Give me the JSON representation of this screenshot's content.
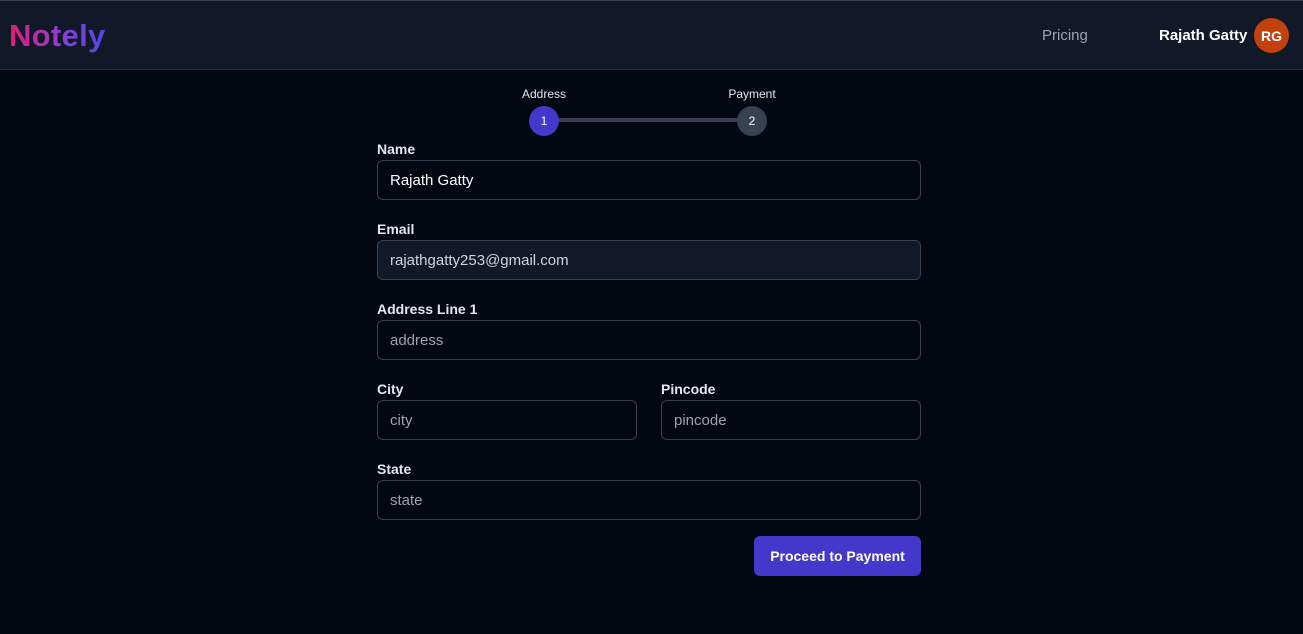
{
  "navbar": {
    "logo": "Notely",
    "pricing_label": "Pricing",
    "user_name": "Rajath Gatty",
    "avatar_initials": "RG"
  },
  "stepper": {
    "steps": [
      {
        "label": "Address",
        "number": "1",
        "state": "active"
      },
      {
        "label": "Payment",
        "number": "2",
        "state": "inactive"
      }
    ]
  },
  "form": {
    "name": {
      "label": "Name",
      "value": "Rajath Gatty"
    },
    "email": {
      "label": "Email",
      "value": "rajathgatty253@gmail.com"
    },
    "address_line1": {
      "label": "Address Line 1",
      "placeholder": "address"
    },
    "city": {
      "label": "City",
      "placeholder": "city"
    },
    "pincode": {
      "label": "Pincode",
      "placeholder": "pincode"
    },
    "state": {
      "label": "State",
      "placeholder": "state"
    },
    "submit_label": "Proceed to Payment"
  },
  "colors": {
    "background": "#030712",
    "navbar": "#111827",
    "accent": "#4338ca",
    "avatar": "#c2410c"
  }
}
